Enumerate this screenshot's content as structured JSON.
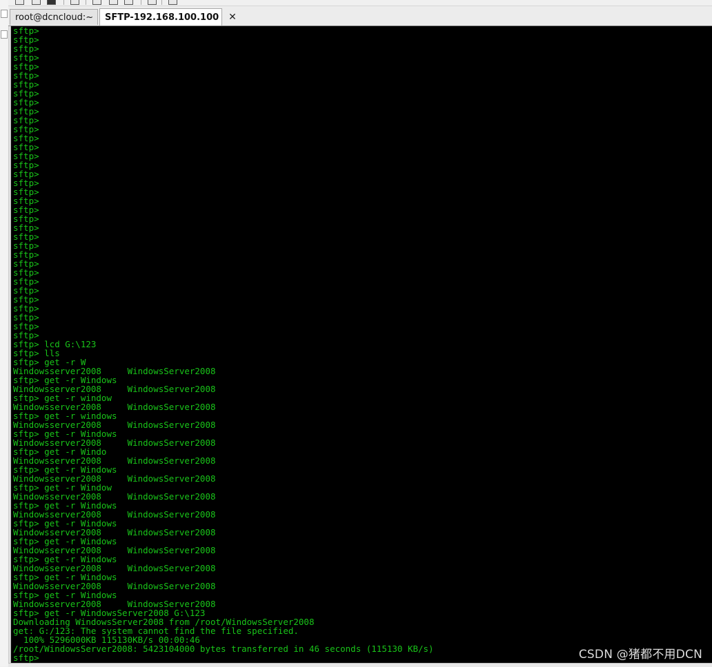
{
  "tabs": [
    {
      "label": "root@dcncloud:~",
      "icon": "check-icon",
      "active": false
    },
    {
      "label": "SFTP-192.168.100.100",
      "icon": "check-icon",
      "active": true,
      "close_glyph": "✕"
    }
  ],
  "terminal": {
    "text_color": "#19c419",
    "background": "#000000",
    "lines": [
      "sftp>",
      "sftp>",
      "sftp>",
      "sftp>",
      "sftp>",
      "sftp>",
      "sftp>",
      "sftp>",
      "sftp>",
      "sftp>",
      "sftp>",
      "sftp>",
      "sftp>",
      "sftp>",
      "sftp>",
      "sftp>",
      "sftp>",
      "sftp>",
      "sftp>",
      "sftp>",
      "sftp>",
      "sftp>",
      "sftp>",
      "sftp>",
      "sftp>",
      "sftp>",
      "sftp>",
      "sftp>",
      "sftp>",
      "sftp>",
      "sftp>",
      "sftp>",
      "sftp>",
      "sftp>",
      "sftp>",
      "sftp> lcd G:\\123",
      "sftp> lls",
      "sftp> get -r W",
      "Windowsserver2008     WindowsServer2008",
      "sftp> get -r Windows",
      "Windowsserver2008     WindowsServer2008",
      "sftp> get -r window",
      "Windowsserver2008     WindowsServer2008",
      "sftp> get -r windows",
      "Windowsserver2008     WindowsServer2008",
      "sftp> get -r Windows",
      "Windowsserver2008     WindowsServer2008",
      "sftp> get -r Windo",
      "Windowsserver2008     WindowsServer2008",
      "sftp> get -r Windows",
      "Windowsserver2008     WindowsServer2008",
      "sftp> get -r Window",
      "Windowsserver2008     WindowsServer2008",
      "sftp> get -r Windows",
      "Windowsserver2008     WindowsServer2008",
      "sftp> get -r Windows",
      "Windowsserver2008     WindowsServer2008",
      "sftp> get -r Windows",
      "Windowsserver2008     WindowsServer2008",
      "sftp> get -r Windows",
      "Windowsserver2008     WindowsServer2008",
      "sftp> get -r Windows",
      "Windowsserver2008     WindowsServer2008",
      "sftp> get -r Windows",
      "Windowsserver2008     WindowsServer2008",
      "sftp> get -r WindowsServer2008 G:\\123",
      "Downloading WindowsServer2008 from /root/WindowsServer2008",
      "get: G:/123: The system cannot find the file specified.",
      "  100% 5296000KB 115130KB/s 00:00:46",
      "/root/WindowsServer2008: 5423104000 bytes transferred in 46 seconds (115130 KB/s)",
      "sftp>"
    ]
  },
  "watermark": "CSDN @猪都不用DCN"
}
